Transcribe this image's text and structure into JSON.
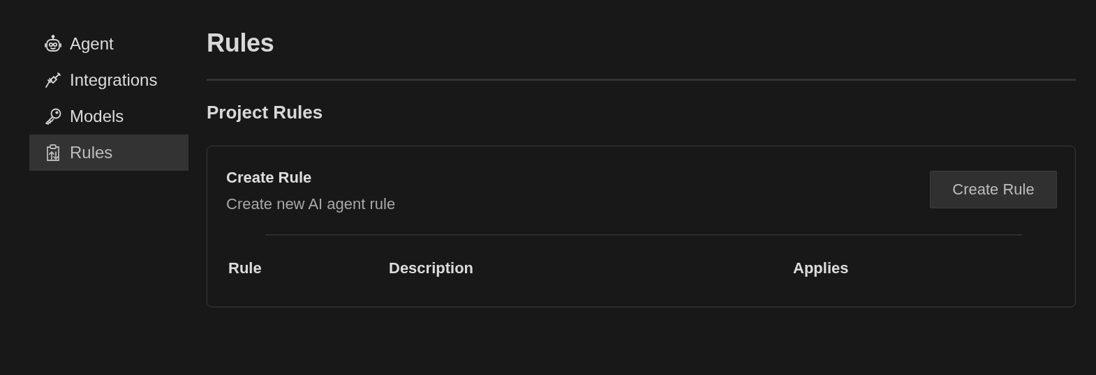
{
  "sidebar": {
    "items": [
      {
        "label": "Agent",
        "selected": false
      },
      {
        "label": "Integrations",
        "selected": false
      },
      {
        "label": "Models",
        "selected": false
      },
      {
        "label": "Rules",
        "selected": true
      }
    ]
  },
  "page": {
    "title": "Rules",
    "section_title": "Project Rules",
    "card": {
      "title": "Create Rule",
      "description": "Create new AI agent rule",
      "button": "Create Rule",
      "table": {
        "columns": [
          "Rule",
          "Description",
          "Applies"
        ]
      }
    }
  }
}
